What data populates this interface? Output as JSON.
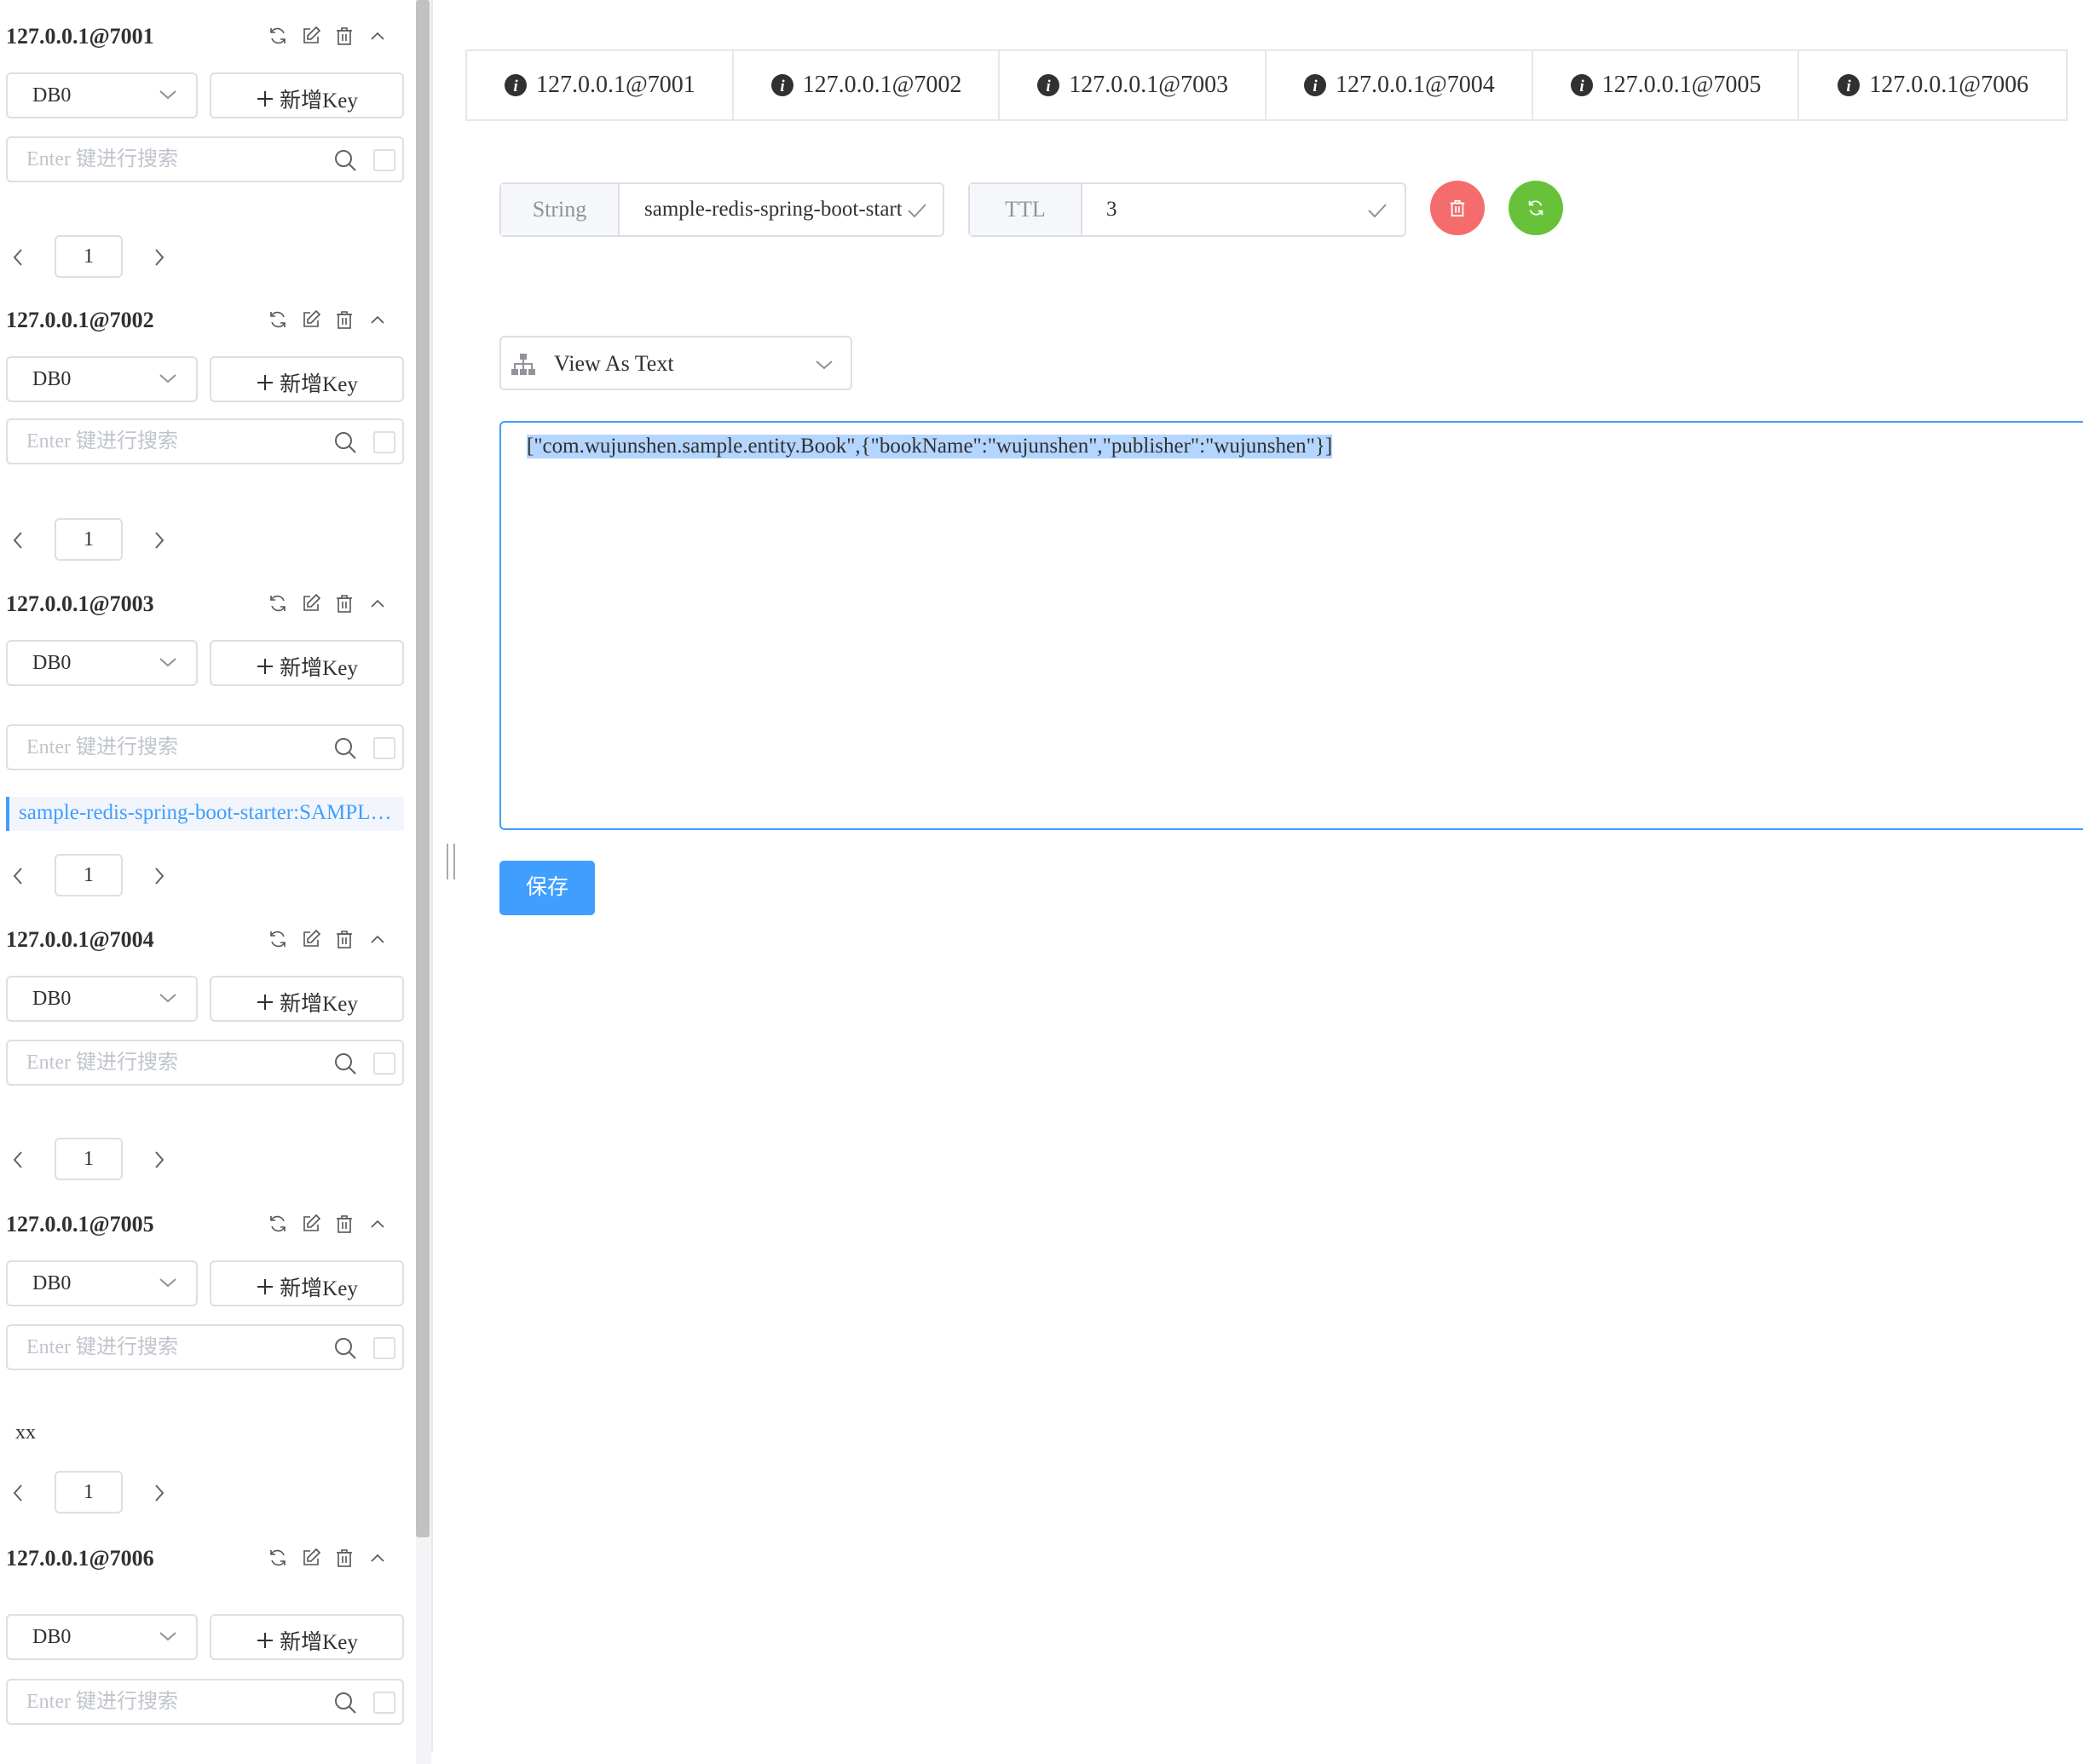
{
  "sidebar": {
    "servers": [
      {
        "name": "127.0.0.1@7001",
        "db": "DB0",
        "new_key_label": "新增Key",
        "search_placeholder": "Enter 键进行搜索",
        "page": "1"
      },
      {
        "name": "127.0.0.1@7002",
        "db": "DB0",
        "new_key_label": "新增Key",
        "search_placeholder": "Enter 键进行搜索",
        "page": "1"
      },
      {
        "name": "127.0.0.1@7003",
        "db": "DB0",
        "new_key_label": "新增Key",
        "search_placeholder": "Enter 键进行搜索",
        "keys": [
          "sample-redis-spring-boot-starter:SAMPLE_BOOKS::wujunshen"
        ],
        "page": "1"
      },
      {
        "name": "127.0.0.1@7004",
        "db": "DB0",
        "new_key_label": "新增Key",
        "search_placeholder": "Enter 键进行搜索",
        "page": "1"
      },
      {
        "name": "127.0.0.1@7005",
        "db": "DB0",
        "new_key_label": "新增Key",
        "search_placeholder": "Enter 键进行搜索",
        "keys": [
          "xx"
        ],
        "page": "1"
      },
      {
        "name": "127.0.0.1@7006",
        "db": "DB0",
        "new_key_label": "新增Key",
        "search_placeholder": "Enter 键进行搜索"
      }
    ],
    "icons": [
      "refresh-icon",
      "edit-icon",
      "delete-icon",
      "collapse-icon"
    ]
  },
  "tabs": [
    "127.0.0.1@7001",
    "127.0.0.1@7002",
    "127.0.0.1@7003",
    "127.0.0.1@7004",
    "127.0.0.1@7005",
    "127.0.0.1@7006"
  ],
  "key_detail": {
    "type_label": "String",
    "key_value": "sample-redis-spring-boot-starter:SAMPLE_BOOKS::wujunshen",
    "ttl_label": "TTL",
    "ttl_value": "3",
    "view_mode": "View As Text",
    "value_text": "[\"com.wujunshen.sample.entity.Book\",{\"bookName\":\"wujunshen\",\"publisher\":\"wujunshen\"}]",
    "save_label": "保存"
  },
  "colors": {
    "accent": "#409eff",
    "delete_button": "#f56c6c",
    "refresh_button": "#67c23a",
    "border": "#dcdfe6",
    "selection": "#b4d5fe"
  }
}
